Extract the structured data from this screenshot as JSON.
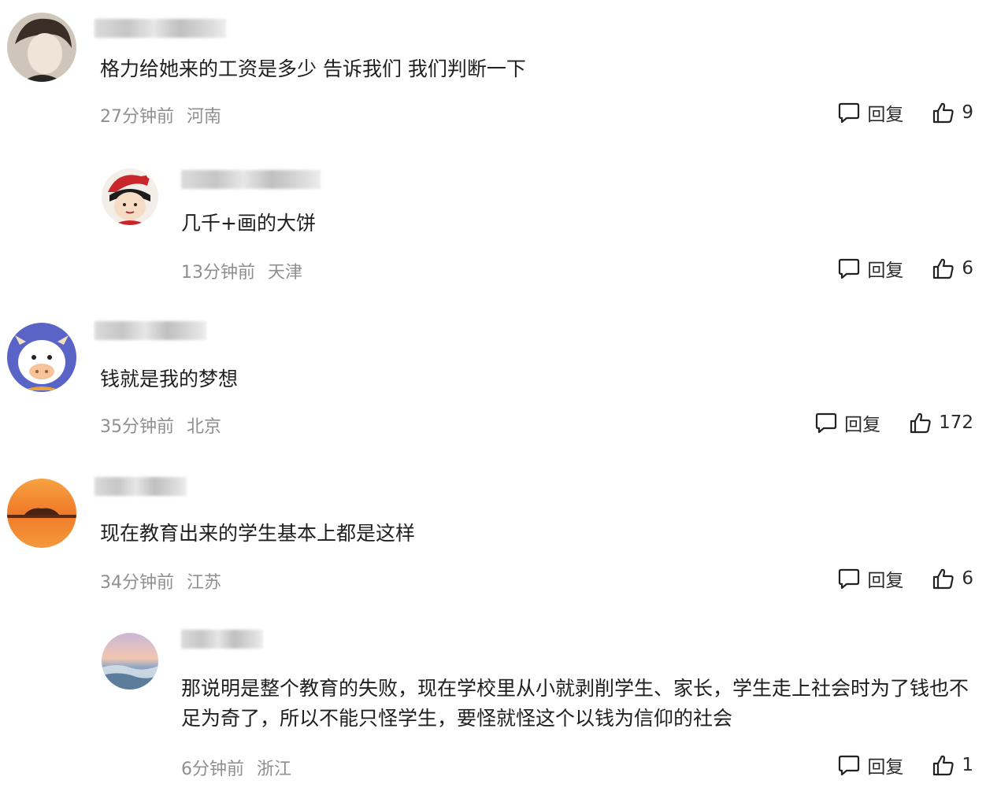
{
  "comments": [
    {
      "text": "格力给她来的工资是多少 告诉我们 我们判断一下",
      "time": "27分钟前",
      "location": "河南",
      "reply_label": "回复",
      "likes": "9"
    },
    {
      "text": "几千+画的大饼",
      "time": "13分钟前",
      "location": "天津",
      "reply_label": "回复",
      "likes": "6"
    },
    {
      "text": "钱就是我的梦想",
      "time": "35分钟前",
      "location": "北京",
      "reply_label": "回复",
      "likes": "172"
    },
    {
      "text": "现在教育出来的学生基本上都是这样",
      "time": "34分钟前",
      "location": "江苏",
      "reply_label": "回复",
      "likes": "6"
    },
    {
      "text": "那说明是整个教育的失败，现在学校里从小就剥削学生、家长，学生走上社会时为了钱也不足为奇了，所以不能只怪学生，要怪就怪这个以钱为信仰的社会",
      "time": "6分钟前",
      "location": "浙江",
      "reply_label": "回复",
      "likes": "1"
    }
  ],
  "icons": {
    "reply": "speech-bubble-icon",
    "like": "thumbs-up-icon"
  },
  "colors": {
    "meta": "#8f8f8f",
    "text": "#1f1f1f"
  }
}
